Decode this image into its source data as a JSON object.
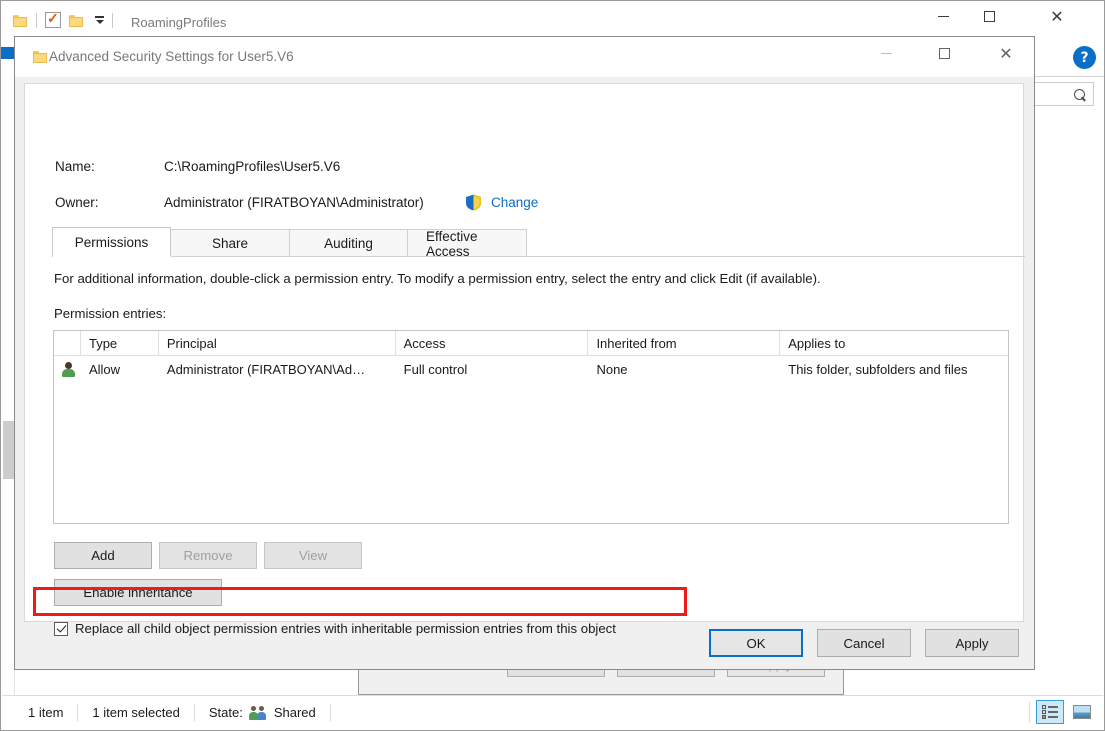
{
  "explorer": {
    "title": "RoamingProfiles",
    "quick_access": {
      "folder_icon": "folder-icon",
      "properties_icon": "properties-checkmark-icon",
      "folder_icon_2": "folder-icon",
      "dropdown_icon": "chevron-down-icon"
    },
    "window_controls": {
      "minimize": "—",
      "maximize": "☐",
      "close": "✕"
    },
    "ribbon_expand_icon": "chevron-down-icon",
    "help_label": "?",
    "search_icon": "search-icon",
    "status": {
      "item_count": "1 item",
      "selected": "1 item selected",
      "state_label": "State:",
      "state_value": "Shared",
      "state_icon": "shared-people-icon"
    },
    "view_buttons": {
      "details_icon": "details-view-icon",
      "large_icons_icon": "large-icons-view-icon"
    }
  },
  "properties_dialog": {
    "ok_label": "OK",
    "cancel_label": "Cancel",
    "apply_label": "Apply"
  },
  "dialog": {
    "title": "Advanced Security Settings for User5.V6",
    "title_icon": "folder-icon",
    "window_controls": {
      "minimize": "—",
      "maximize": "☐",
      "close": "✕"
    },
    "fields": {
      "name_label": "Name:",
      "name_value": "C:\\RoamingProfiles\\User5.V6",
      "owner_label": "Owner:",
      "owner_value": "Administrator (FIRATBOYAN\\Administrator)",
      "change_link": "Change",
      "shield_icon": "uac-shield-icon"
    },
    "tabs": [
      {
        "label": "Permissions",
        "active": true
      },
      {
        "label": "Share",
        "active": false
      },
      {
        "label": "Auditing",
        "active": false
      },
      {
        "label": "Effective Access",
        "active": false
      }
    ],
    "info_text": "For additional information, double-click a permission entry. To modify a permission entry, select the entry and click Edit (if available).",
    "entries_label": "Permission entries:",
    "table": {
      "columns": [
        "",
        "Type",
        "Principal",
        "Access",
        "Inherited from",
        "Applies to"
      ],
      "rows": [
        {
          "icon": "user-icon",
          "type": "Allow",
          "principal": "Administrator (FIRATBOYAN\\Ad…",
          "access": "Full control",
          "inherited_from": "None",
          "applies_to": "This folder, subfolders and files"
        }
      ]
    },
    "buttons": {
      "add": "Add",
      "remove": "Remove",
      "view": "View",
      "enable_inheritance": "Enable inheritance"
    },
    "replace_checkbox": {
      "label": "Replace all child object permission entries with inheritable permission entries from this object",
      "checked": true
    },
    "actions": {
      "ok": "OK",
      "cancel": "Cancel",
      "apply": "Apply"
    }
  },
  "colors": {
    "accent_blue": "#0c6fc7",
    "link_blue": "#0a6fc2",
    "annotation_red": "#ef1b1b",
    "dialog_bg": "#f0f0f0"
  }
}
